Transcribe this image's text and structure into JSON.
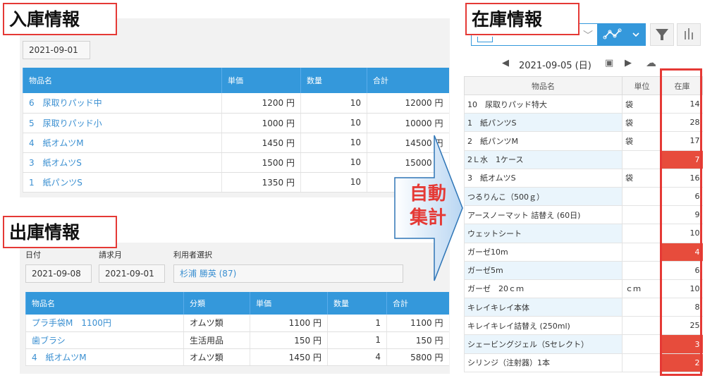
{
  "inbound": {
    "title": "入庫情報",
    "date": "2021-09-01",
    "columns": [
      "物品名",
      "単価",
      "数量",
      "合計"
    ],
    "rows": [
      {
        "name": "6　尿取りパッド中",
        "price": "1200 円",
        "qty": "10",
        "total": "12000 円"
      },
      {
        "name": "5　尿取りパッド小",
        "price": "1000 円",
        "qty": "10",
        "total": "10000 円"
      },
      {
        "name": "4　紙オムツM",
        "price": "1450 円",
        "qty": "10",
        "total": "14500 円"
      },
      {
        "name": "3　紙オムツS",
        "price": "1500 円",
        "qty": "10",
        "total": "15000 円"
      },
      {
        "name": "1　紙パンツS",
        "price": "1350 円",
        "qty": "10",
        "total": ""
      }
    ]
  },
  "outbound": {
    "title": "出庫情報",
    "labels": {
      "date": "日付",
      "billing": "請求月",
      "user": "利用者選択"
    },
    "date": "2021-09-08",
    "billing_month": "2021-09-01",
    "user": "杉浦 勝英 (87)",
    "columns": [
      "物品名",
      "分類",
      "単価",
      "数量",
      "合計"
    ],
    "rows": [
      {
        "name": "プラ手袋M　1100円",
        "cat": "オムツ類",
        "price": "1100 円",
        "qty": "1",
        "total": "1100 円"
      },
      {
        "name": "歯ブラシ",
        "cat": "生活用品",
        "price": "150 円",
        "qty": "1",
        "total": "150 円"
      },
      {
        "name": "4　紙オムツM",
        "cat": "オムツ類",
        "price": "1450 円",
        "qty": "4",
        "total": "5800 円"
      }
    ]
  },
  "arrow": {
    "line1": "自動",
    "line2": "集計"
  },
  "inventory": {
    "title": "在庫情報",
    "date": "2021-09-05 (日)",
    "columns": [
      "物品名",
      "単位",
      "在庫"
    ],
    "rows": [
      {
        "name": "10　尿取りパッド特大",
        "unit": "袋",
        "stock": "14",
        "low": false
      },
      {
        "name": "1　紙パンツS",
        "unit": "袋",
        "stock": "28",
        "low": false
      },
      {
        "name": "2　紙パンツM",
        "unit": "袋",
        "stock": "17",
        "low": false
      },
      {
        "name": "2Ｌ水　1ケース",
        "unit": "",
        "stock": "7",
        "low": true
      },
      {
        "name": "3　紙オムツS",
        "unit": "袋",
        "stock": "16",
        "low": false
      },
      {
        "name": "つるりんこ（500ｇ）",
        "unit": "",
        "stock": "6",
        "low": false
      },
      {
        "name": "アースノーマット 詰替え (60日)",
        "unit": "",
        "stock": "9",
        "low": false
      },
      {
        "name": "ウェットシート",
        "unit": "",
        "stock": "10",
        "low": false
      },
      {
        "name": "ガーゼ10m",
        "unit": "",
        "stock": "4",
        "low": true
      },
      {
        "name": "ガーゼ5m",
        "unit": "",
        "stock": "6",
        "low": false
      },
      {
        "name": "ガーゼ　20ｃｍ",
        "unit": "ｃｍ",
        "stock": "10",
        "low": false
      },
      {
        "name": "キレイキレイ本体",
        "unit": "",
        "stock": "8",
        "low": false
      },
      {
        "name": "キレイキレイ詰替え (250ml)",
        "unit": "",
        "stock": "25",
        "low": false
      },
      {
        "name": "シェービングジェル（Sセレクト）",
        "unit": "",
        "stock": "3",
        "low": true
      },
      {
        "name": "シリンジ（注射器）1本",
        "unit": "",
        "stock": "2",
        "low": true
      }
    ]
  },
  "colors": {
    "header_blue": "#3498db",
    "link_blue": "#3a8fd1",
    "alert_red": "#e74c3c",
    "frame_red": "#e53935"
  }
}
